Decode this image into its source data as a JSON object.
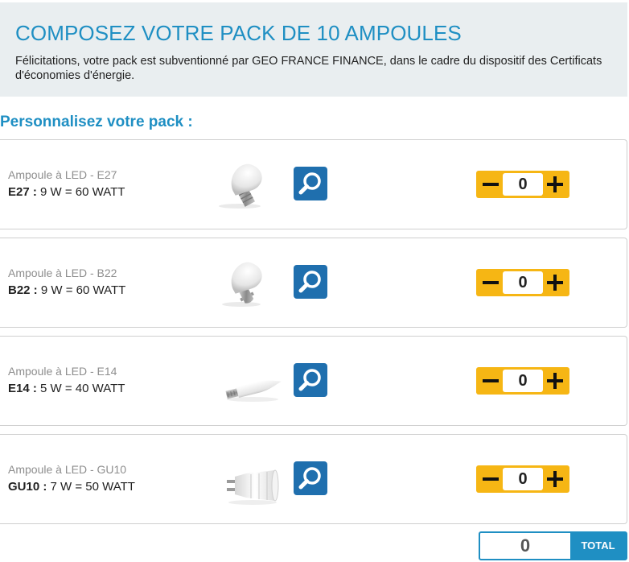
{
  "header": {
    "title": "COMPOSEZ VOTRE PACK DE 10 AMPOULES",
    "text": "Félicitations, votre pack est subventionné par GEO FRANCE FINANCE, dans le cadre du dispositif des Certificats d'économies d'énergie."
  },
  "section_title": "Personnalisez votre pack :",
  "products": [
    {
      "name": "Ampoule à LED - E27",
      "code": "E27 :",
      "spec": " 9 W = 60 WATT",
      "quantity": "0",
      "image": "bulb-e27-image"
    },
    {
      "name": "Ampoule à LED - B22",
      "code": "B22 :",
      "spec": " 9 W = 60 WATT",
      "quantity": "0",
      "image": "bulb-b22-image"
    },
    {
      "name": "Ampoule à LED - E14",
      "code": "E14 :",
      "spec": " 5 W = 40 WATT",
      "quantity": "0",
      "image": "bulb-e14-image"
    },
    {
      "name": "Ampoule à LED - GU10",
      "code": "GU10 :",
      "spec": " 7 W = 50 WATT",
      "quantity": "0",
      "image": "bulb-gu10-image"
    }
  ],
  "total": {
    "value": "0",
    "label": "TOTAL"
  },
  "icons": {
    "zoom": "magnifier-icon",
    "minus": "minus-icon",
    "plus": "plus-icon"
  },
  "colors": {
    "accent": "#1f8fc3",
    "stepper": "#f6b614",
    "zoom_button": "#1f6fae",
    "header_bg": "#e9eef0"
  }
}
